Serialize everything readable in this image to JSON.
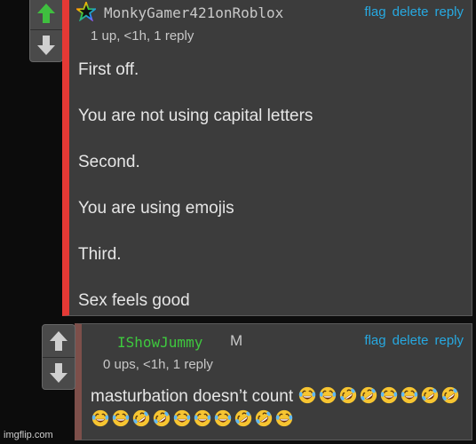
{
  "comments": [
    {
      "username": "MonkyGamer421onRoblox",
      "meta": "1 up, <1h, 1 reply",
      "actions": {
        "flag": "flag",
        "delete": "delete",
        "reply": "reply"
      },
      "lines": [
        "First off.",
        "You are not using capital letters",
        "Second.",
        "You are using emojis",
        "Third.",
        "Sex feels good"
      ],
      "accent": "#e53935",
      "avatar_icon": "rainbow-star-icon"
    },
    {
      "username": "IShowJummy",
      "badge": "M",
      "meta": "0 ups, <1h, 1 reply",
      "actions": {
        "flag": "flag",
        "delete": "delete",
        "reply": "reply"
      },
      "text": "masturbation doesn’t count",
      "emojis": [
        "joy",
        "joy",
        "rofl",
        "rofl",
        "joy",
        "joy",
        "rofl",
        "rofl",
        "joy",
        "joy",
        "rofl",
        "rofl",
        "joy",
        "joy",
        "joy",
        "rofl",
        "rofl",
        "joy"
      ],
      "accent": "#7d4f4a",
      "username_color": "#3ec93e"
    }
  ],
  "watermark": "imgflip.com",
  "colors": {
    "upvote": "#3fbf3f",
    "downvote": "#cfcfcf",
    "link": "#27a9e1"
  }
}
